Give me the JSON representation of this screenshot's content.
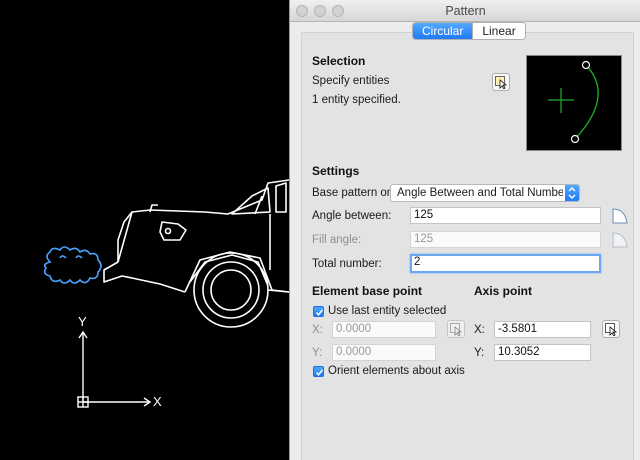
{
  "window": {
    "title": "Pattern"
  },
  "tabs": [
    {
      "label": "Circular",
      "active": true
    },
    {
      "label": "Linear",
      "active": false
    }
  ],
  "selection": {
    "heading": "Selection",
    "specify_label": "Specify entities",
    "status": "1 entity specified."
  },
  "settings": {
    "heading": "Settings",
    "base_pattern_label": "Base pattern on:",
    "base_pattern_value": "Angle Between and Total Number of Elements",
    "angle_between_label": "Angle between:",
    "angle_between_value": "125",
    "fill_angle_label": "Fill angle:",
    "fill_angle_value": "125",
    "total_number_label": "Total number:",
    "total_number_value": "2"
  },
  "element_base_point": {
    "heading": "Element base point",
    "use_last_label": "Use last entity selected",
    "use_last_checked": true,
    "x_label": "X:",
    "x_value": "0.0000",
    "y_label": "Y:",
    "y_value": "0.0000",
    "orient_label": "Orient elements about axis",
    "orient_checked": true
  },
  "axis_point": {
    "heading": "Axis point",
    "x_label": "X:",
    "x_value": "-3.5801",
    "y_label": "Y:",
    "y_value": "10.3052"
  },
  "canvas": {
    "axis_x_label": "X",
    "axis_y_label": "Y",
    "background": "#000000",
    "entity_color": "#ffffff",
    "selected_color": "#4aa3ff"
  },
  "colors": {
    "accent": "#1f7af5",
    "preview_arc": "#1fae2d"
  }
}
